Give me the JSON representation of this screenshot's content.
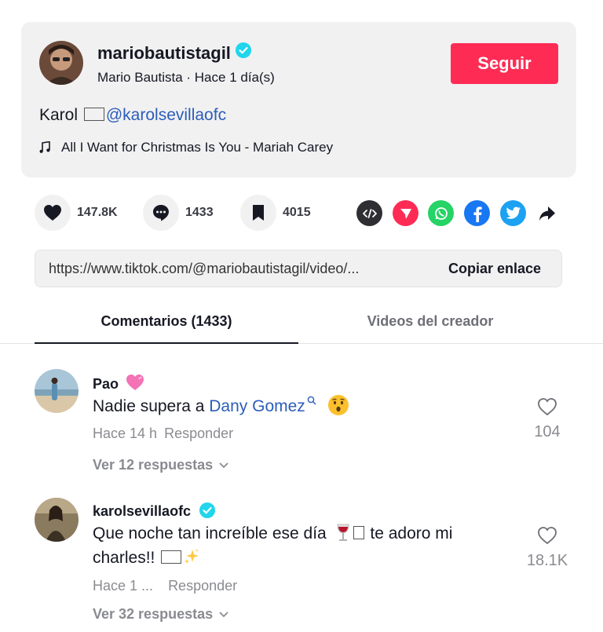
{
  "post": {
    "username": "mariobautistagil",
    "display_name": "Mario Bautista",
    "separator": " · ",
    "time": "Hace 1 día(s)",
    "follow_label": "Seguir",
    "caption_text": "Karol ",
    "caption_mention": "@karolsevillaofc",
    "music": "All I Want for Christmas Is You - Mariah Carey"
  },
  "actions": {
    "likes": "147.8K",
    "comments": "1433",
    "saves": "4015"
  },
  "link": {
    "url": "https://www.tiktok.com/@mariobautistagil/video/...",
    "copy_label": "Copiar enlace"
  },
  "tabs": [
    {
      "label": "Comentarios (1433)",
      "active": true
    },
    {
      "label": "Videos del creador",
      "active": false
    }
  ],
  "comments": [
    {
      "username": "Pao",
      "text_before": "Nadie supera a ",
      "mention": "Dany Gomez",
      "time": "Hace 14 h",
      "reply_label": "Responder",
      "replies_label": "Ver 12 respuestas",
      "likes": "104"
    },
    {
      "username": "karolsevillaofc",
      "text_line1": "Que noche tan increíble ese día",
      "text_line1b": "te adoro mi",
      "text_line2": "charles!!",
      "time": "Hace 1 ...",
      "reply_label": "Responder",
      "replies_label": "Ver 32 respuestas",
      "likes": "18.1K"
    }
  ],
  "colors": {
    "accent": "#fe2c55",
    "mention": "#2b5db9",
    "verified": "#20d5ec",
    "muted": "#8a8b91"
  }
}
